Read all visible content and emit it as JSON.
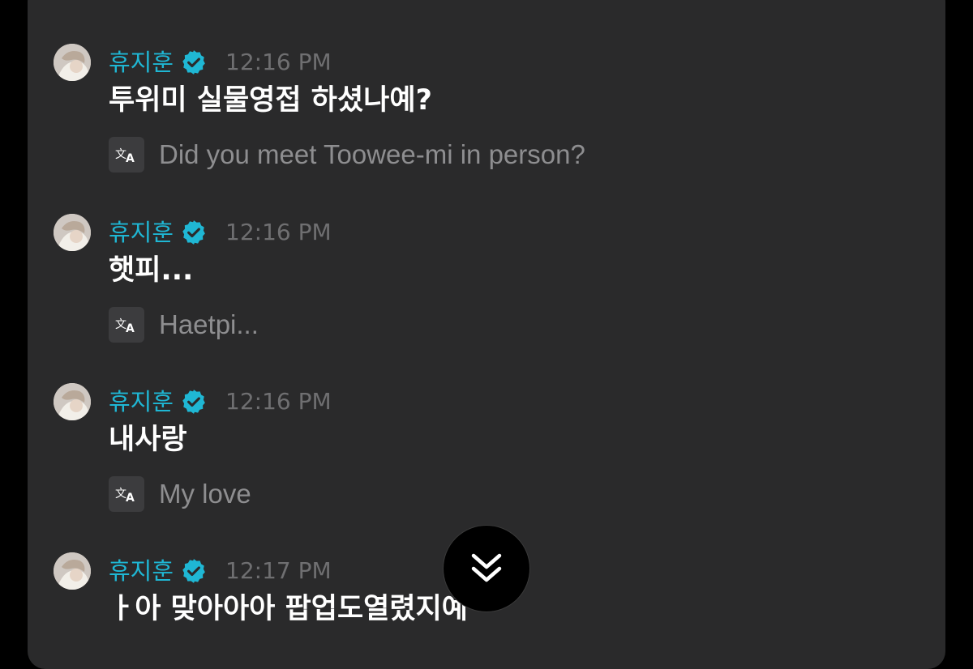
{
  "messages": [
    {
      "author": "휴지훈",
      "time": "12:16 PM",
      "text": "투위미 실물영접 하셨나예?",
      "translation": "Did you meet Toowee-mi in person?"
    },
    {
      "author": "휴지훈",
      "time": "12:16 PM",
      "text": "햇피...",
      "translation": "Haetpi..."
    },
    {
      "author": "휴지훈",
      "time": "12:16 PM",
      "text": "내사랑",
      "translation": "My love"
    },
    {
      "author": "휴지훈",
      "time": "12:17 PM",
      "text": "ㅏ아 맞아아아 팝업도열렸지예",
      "translation": ""
    }
  ],
  "icons": {
    "badge": "verified-badge-icon",
    "translate": "translate-icon",
    "scroll": "chevron-double-down-icon"
  },
  "colors": {
    "author": "#1fb7d4",
    "background": "#2a2a2b",
    "text": "#ffffff",
    "translation": "#8e8e90",
    "time": "#6f6f71"
  }
}
